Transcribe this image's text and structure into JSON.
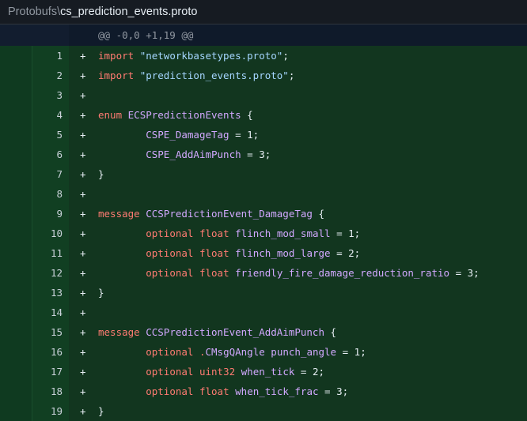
{
  "header": {
    "root": "Protobufs",
    "separator": "\\",
    "filename": "cs_prediction_events.proto"
  },
  "hunk": {
    "text": "@@ -0,0 +1,19 @@"
  },
  "colors": {
    "added_bg": "#12361f",
    "added_gutter": "#113f22",
    "keyword": "#ff7b72",
    "string": "#a5d6ff",
    "identifier": "#d2a8ff"
  },
  "lines": [
    {
      "n": "1",
      "marker": "+",
      "indent": "",
      "tokens": [
        [
          "kw",
          "import"
        ],
        [
          "plain",
          " "
        ],
        [
          "str",
          "\"networkbasetypes.proto\""
        ],
        [
          "plain",
          ";"
        ]
      ]
    },
    {
      "n": "2",
      "marker": "+",
      "indent": "",
      "tokens": [
        [
          "kw",
          "import"
        ],
        [
          "plain",
          " "
        ],
        [
          "str",
          "\"prediction_events.proto\""
        ],
        [
          "plain",
          ";"
        ]
      ]
    },
    {
      "n": "3",
      "marker": "+",
      "indent": "",
      "tokens": []
    },
    {
      "n": "4",
      "marker": "+",
      "indent": "",
      "tokens": [
        [
          "kw",
          "enum"
        ],
        [
          "plain",
          " "
        ],
        [
          "ident",
          "ECSPredictionEvents"
        ],
        [
          "plain",
          " {"
        ]
      ]
    },
    {
      "n": "5",
      "marker": "+",
      "indent": "        ",
      "tokens": [
        [
          "field",
          "CSPE_DamageTag"
        ],
        [
          "plain",
          " = 1;"
        ]
      ]
    },
    {
      "n": "6",
      "marker": "+",
      "indent": "        ",
      "tokens": [
        [
          "field",
          "CSPE_AddAimPunch"
        ],
        [
          "plain",
          " = 3;"
        ]
      ]
    },
    {
      "n": "7",
      "marker": "+",
      "indent": "",
      "tokens": [
        [
          "plain",
          "}"
        ]
      ]
    },
    {
      "n": "8",
      "marker": "+",
      "indent": "",
      "tokens": []
    },
    {
      "n": "9",
      "marker": "+",
      "indent": "",
      "tokens": [
        [
          "kw",
          "message"
        ],
        [
          "plain",
          " "
        ],
        [
          "ident",
          "CCSPredictionEvent_DamageTag"
        ],
        [
          "plain",
          " {"
        ]
      ]
    },
    {
      "n": "10",
      "marker": "+",
      "indent": "        ",
      "tokens": [
        [
          "kw",
          "optional"
        ],
        [
          "plain",
          " "
        ],
        [
          "kw",
          "float"
        ],
        [
          "plain",
          " "
        ],
        [
          "field",
          "flinch_mod_small"
        ],
        [
          "plain",
          " = 1;"
        ]
      ]
    },
    {
      "n": "11",
      "marker": "+",
      "indent": "        ",
      "tokens": [
        [
          "kw",
          "optional"
        ],
        [
          "plain",
          " "
        ],
        [
          "kw",
          "float"
        ],
        [
          "plain",
          " "
        ],
        [
          "field",
          "flinch_mod_large"
        ],
        [
          "plain",
          " = 2;"
        ]
      ]
    },
    {
      "n": "12",
      "marker": "+",
      "indent": "        ",
      "tokens": [
        [
          "kw",
          "optional"
        ],
        [
          "plain",
          " "
        ],
        [
          "kw",
          "float"
        ],
        [
          "plain",
          " "
        ],
        [
          "field",
          "friendly_fire_damage_reduction_ratio"
        ],
        [
          "plain",
          " = 3;"
        ]
      ]
    },
    {
      "n": "13",
      "marker": "+",
      "indent": "",
      "tokens": [
        [
          "plain",
          "}"
        ]
      ]
    },
    {
      "n": "14",
      "marker": "+",
      "indent": "",
      "tokens": []
    },
    {
      "n": "15",
      "marker": "+",
      "indent": "",
      "tokens": [
        [
          "kw",
          "message"
        ],
        [
          "plain",
          " "
        ],
        [
          "ident",
          "CCSPredictionEvent_AddAimPunch"
        ],
        [
          "plain",
          " {"
        ]
      ]
    },
    {
      "n": "16",
      "marker": "+",
      "indent": "        ",
      "tokens": [
        [
          "kw",
          "optional"
        ],
        [
          "plain",
          " "
        ],
        [
          "kw",
          "."
        ],
        [
          "ident",
          "CMsgQAngle"
        ],
        [
          "plain",
          " "
        ],
        [
          "field",
          "punch_angle"
        ],
        [
          "plain",
          " = 1;"
        ]
      ]
    },
    {
      "n": "17",
      "marker": "+",
      "indent": "        ",
      "tokens": [
        [
          "kw",
          "optional"
        ],
        [
          "plain",
          " "
        ],
        [
          "kw",
          "uint32"
        ],
        [
          "plain",
          " "
        ],
        [
          "field",
          "when_tick"
        ],
        [
          "plain",
          " = 2;"
        ]
      ]
    },
    {
      "n": "18",
      "marker": "+",
      "indent": "        ",
      "tokens": [
        [
          "kw",
          "optional"
        ],
        [
          "plain",
          " "
        ],
        [
          "kw",
          "float"
        ],
        [
          "plain",
          " "
        ],
        [
          "field",
          "when_tick_frac"
        ],
        [
          "plain",
          " = 3;"
        ]
      ]
    },
    {
      "n": "19",
      "marker": "+",
      "indent": "",
      "tokens": [
        [
          "plain",
          "}"
        ]
      ]
    }
  ]
}
